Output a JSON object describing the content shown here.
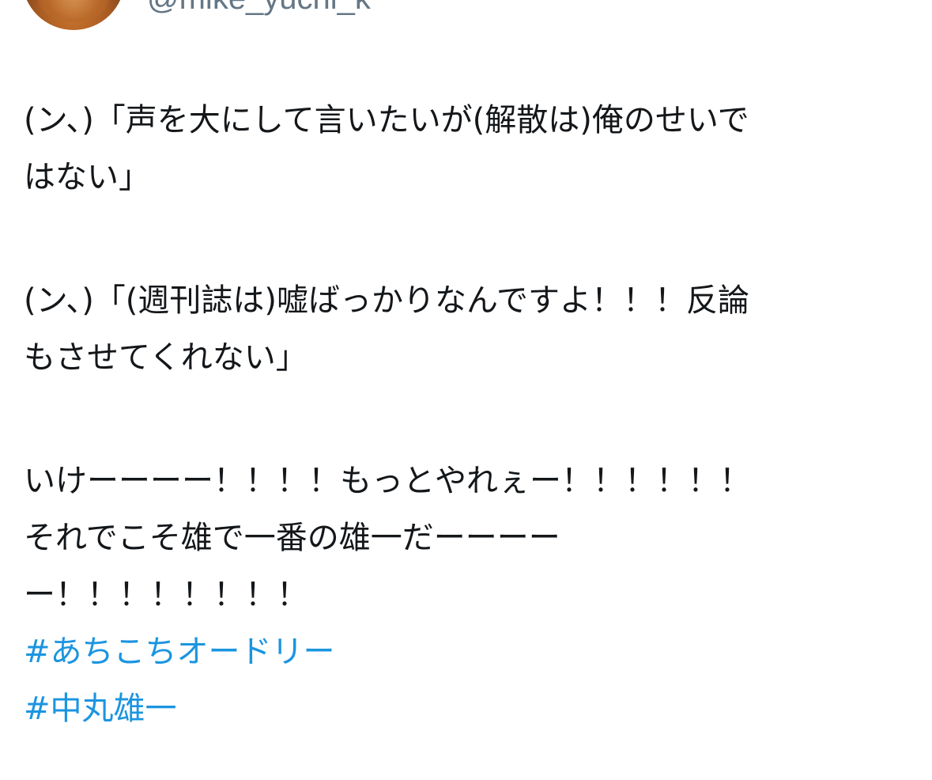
{
  "user": {
    "handle": "@mike_yuchi_k"
  },
  "tweet": {
    "paragraph1": [
      "(ン、)「声を大にして言いたいが(解散は)俺のせいで",
      "はない」"
    ],
    "paragraph2": [
      "(ン、)「(週刊誌は)嘘ばっかりなんですよ！！！反論",
      "もさせてくれない」"
    ],
    "paragraph3": [
      "いけーーーー！！！！もっとやれぇー！！！！！！",
      "それでこそ雄で一番の雄一だーーーー",
      "ー！！！！！！！！"
    ],
    "hashtags": [
      "#あちこちオードリー",
      "#中丸雄一"
    ]
  },
  "colors": {
    "text": "#14171a",
    "handle": "#657786",
    "link": "#1b95e0",
    "background": "#ffffff"
  }
}
